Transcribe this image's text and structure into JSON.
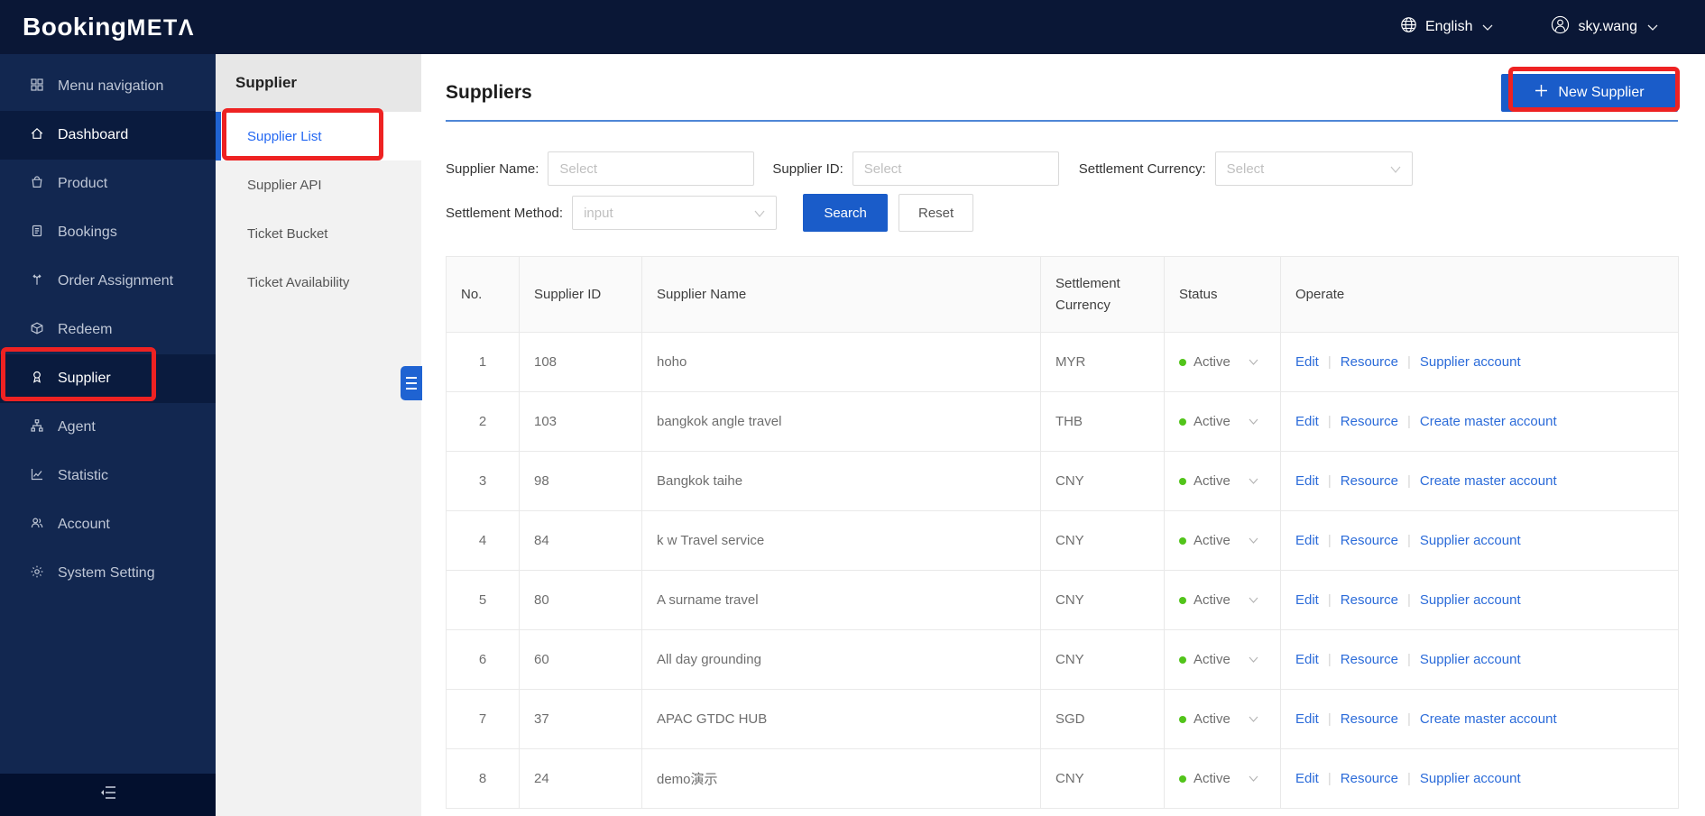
{
  "brand": {
    "name_part1": "Booking",
    "name_part2": "METΛ"
  },
  "topbar": {
    "language_label": "English",
    "user_name": "sky.wang"
  },
  "sidebar": {
    "items": [
      {
        "label": "Menu navigation"
      },
      {
        "label": "Dashboard"
      },
      {
        "label": "Product"
      },
      {
        "label": "Bookings"
      },
      {
        "label": "Order Assignment"
      },
      {
        "label": "Redeem"
      },
      {
        "label": "Supplier"
      },
      {
        "label": "Agent"
      },
      {
        "label": "Statistic"
      },
      {
        "label": "Account"
      },
      {
        "label": "System Setting"
      }
    ]
  },
  "submenu": {
    "title": "Supplier",
    "items": [
      {
        "label": "Supplier List"
      },
      {
        "label": "Supplier API"
      },
      {
        "label": "Ticket Bucket"
      },
      {
        "label": "Ticket Availability"
      }
    ]
  },
  "page": {
    "title": "Suppliers",
    "new_button_label": "New Supplier"
  },
  "filters": {
    "supplier_name": {
      "label": "Supplier Name:",
      "placeholder": "Select"
    },
    "supplier_id": {
      "label": "Supplier ID:",
      "placeholder": "Select"
    },
    "settlement_currency": {
      "label": "Settlement Currency:",
      "placeholder": "Select"
    },
    "settlement_method": {
      "label": "Settlement Method:",
      "placeholder": "input"
    },
    "search_label": "Search",
    "reset_label": "Reset"
  },
  "table": {
    "columns": [
      "No.",
      "Supplier ID",
      "Supplier Name",
      "Settlement Currency",
      "Status",
      "Operate"
    ],
    "rows": [
      {
        "no": "1",
        "id": "108",
        "name": "hoho",
        "currency": "MYR",
        "status": "Active",
        "actions": [
          "Edit",
          "Resource",
          "Supplier account"
        ]
      },
      {
        "no": "2",
        "id": "103",
        "name": "bangkok angle travel",
        "currency": "THB",
        "status": "Active",
        "actions": [
          "Edit",
          "Resource",
          "Create master account"
        ]
      },
      {
        "no": "3",
        "id": "98",
        "name": "Bangkok taihe",
        "currency": "CNY",
        "status": "Active",
        "actions": [
          "Edit",
          "Resource",
          "Create master account"
        ]
      },
      {
        "no": "4",
        "id": "84",
        "name": "k w Travel service",
        "currency": "CNY",
        "status": "Active",
        "actions": [
          "Edit",
          "Resource",
          "Supplier account"
        ]
      },
      {
        "no": "5",
        "id": "80",
        "name": "A surname travel",
        "currency": "CNY",
        "status": "Active",
        "actions": [
          "Edit",
          "Resource",
          "Supplier account"
        ]
      },
      {
        "no": "6",
        "id": "60",
        "name": "All day grounding",
        "currency": "CNY",
        "status": "Active",
        "actions": [
          "Edit",
          "Resource",
          "Supplier account"
        ]
      },
      {
        "no": "7",
        "id": "37",
        "name": "APAC GTDC HUB",
        "currency": "SGD",
        "status": "Active",
        "actions": [
          "Edit",
          "Resource",
          "Create master account"
        ]
      },
      {
        "no": "8",
        "id": "24",
        "name": "demo演示",
        "currency": "CNY",
        "status": "Active",
        "actions": [
          "Edit",
          "Resource",
          "Supplier account"
        ]
      }
    ]
  },
  "colors": {
    "header_navy": "#0a1736",
    "sidebar_navy": "#122750",
    "primary_blue": "#1a5cc9",
    "link_blue": "#2b6bd9",
    "active_green": "#52c41a",
    "annotation_red": "#ee2222"
  }
}
